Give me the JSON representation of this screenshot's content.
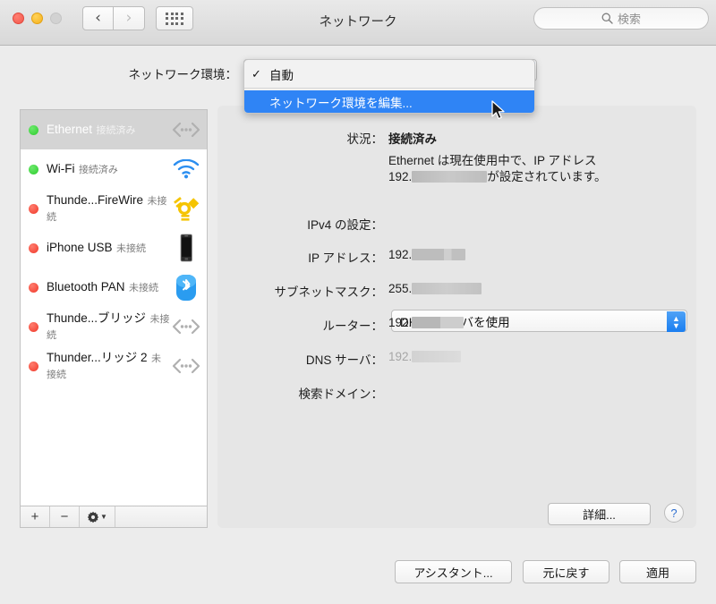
{
  "window": {
    "title": "ネットワーク",
    "traffic_lights": [
      "close",
      "minimize",
      "zoom-disabled"
    ]
  },
  "toolbar": {
    "back_icon": "chevron-left-icon",
    "forward_icon": "chevron-right-icon",
    "show_all_icon": "grid-icon",
    "search_placeholder": "検索",
    "search_icon": "search-icon"
  },
  "location": {
    "label": "ネットワーク環境：",
    "selected": "自動",
    "menu_open": true,
    "menu_items": [
      {
        "label": "自動",
        "checked": true,
        "highlighted": false
      },
      {
        "label": "ネットワーク環境を編集...",
        "checked": false,
        "highlighted": true
      }
    ]
  },
  "sidebar": {
    "services": [
      {
        "name": "Ethernet",
        "status": "接続済み",
        "dot": "green",
        "icon": "ethernet-icon",
        "selected": true
      },
      {
        "name": "Wi-Fi",
        "status": "接続済み",
        "dot": "green",
        "icon": "wifi-icon",
        "selected": false
      },
      {
        "name": "Thunde...FireWire",
        "status": "未接続",
        "dot": "red",
        "icon": "firewire-icon",
        "selected": false
      },
      {
        "name": "iPhone USB",
        "status": "未接続",
        "dot": "red",
        "icon": "iphone-icon",
        "selected": false
      },
      {
        "name": "Bluetooth PAN",
        "status": "未接続",
        "dot": "red",
        "icon": "bluetooth-icon",
        "selected": false
      },
      {
        "name": "Thunde...ブリッジ",
        "status": "未接続",
        "dot": "red",
        "icon": "ethernet-icon",
        "selected": false
      },
      {
        "name": "Thunder...リッジ 2",
        "status": "未接続",
        "dot": "red",
        "icon": "ethernet-icon",
        "selected": false
      }
    ],
    "toolbar": {
      "add": "+",
      "remove": "−",
      "action_icon": "gear-icon",
      "action_chevron": "chevron-down-icon"
    }
  },
  "detail": {
    "status_label": "状況：",
    "status_value": "接続済み",
    "status_desc_line1": "Ethernet は現在使用中で、IP アドレス",
    "status_desc_line2_prefix": "192.",
    "status_desc_line2_suffix": "が設定されています。",
    "ipv4_label": "IPv4 の設定：",
    "ipv4_value": "DHCP サーバを使用",
    "fields": [
      {
        "label": "IP アドレス：",
        "prefix": "192.",
        "redacted": true,
        "dim": false
      },
      {
        "label": "サブネットマスク：",
        "prefix": "255.",
        "redacted": true,
        "dim": false
      },
      {
        "label": "ルーター：",
        "prefix": "192.",
        "redacted": true,
        "dim": false
      },
      {
        "label": "DNS サーバ：",
        "prefix": "192.",
        "redacted": true,
        "dim": true
      },
      {
        "label": "検索ドメイン：",
        "prefix": "",
        "redacted": false,
        "dim": false
      }
    ]
  },
  "buttons": {
    "advanced": "詳細...",
    "help": "?",
    "assistant": "アシスタント...",
    "revert": "元に戻す",
    "apply": "適用"
  },
  "colors": {
    "accent_blue": "#2f84f5",
    "connected_green": "#2ecc2e",
    "disconnected_red": "#f0392a",
    "window_bg": "#ececec",
    "panel_bg": "#e6e6e6"
  }
}
